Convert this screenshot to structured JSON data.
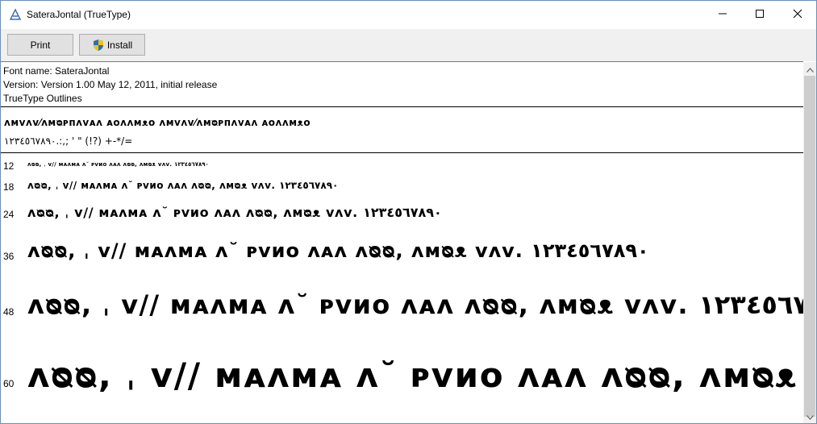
{
  "window": {
    "title": "SateraJontal (TrueType)",
    "icon": "font-icon",
    "controls": [
      "minimize-icon",
      "maximize-icon",
      "close-icon"
    ]
  },
  "toolbar": {
    "print_label": "Print",
    "install_label": "Install",
    "install_icon": "shield-icon"
  },
  "info": {
    "font_name": "Font name: SateraJontal",
    "version": "Version: Version 1.00 May 12, 2011, initial release",
    "outline": "TrueType Outlines"
  },
  "charset": {
    "letters": "ᴧᴍᴠᴧᴠ⁄ᴧᴍᴓᴩᴨᴧᴠᴀᴧ ᴀᴏᴧᴧᴍᴥᴏ ᴧᴍᴠᴧᴠ⁄ᴧᴍᴓᴩᴨᴧᴠᴀᴧ ᴀᴏᴧᴧᴍᴥᴏ",
    "digits": "١٢٣٤٥٦٧٨٩٠.:,; ' \" (!?) +-*/="
  },
  "samples": {
    "text": "ᴧᴓᴓ, ˌ ᴠ// ᴍᴀᴧᴍᴀ ᴧ˘ ᴩᴠᴎᴏ ᴧᴀᴧ ᴧᴓᴓ, ᴧᴍᴓᴥ ᴠᴧᴠ. ١٢٣٤٥٦٧٨٩٠",
    "sizes": [
      "12",
      "18",
      "24",
      "36",
      "48",
      "60"
    ]
  },
  "colors": {
    "window_border": "#6d8fb3",
    "toolbar_bg": "#f0f0f0",
    "button_bg": "#e1e1e1",
    "scrollbar_thumb": "#cdcdcd"
  }
}
